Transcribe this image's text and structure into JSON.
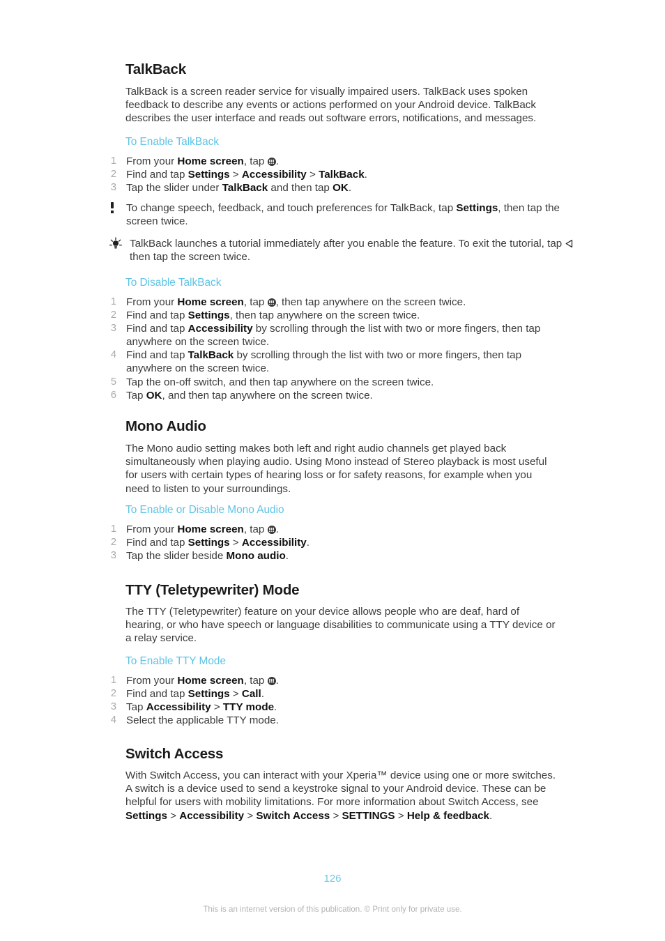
{
  "page": {
    "number": "126",
    "footer_note": "This is an internet version of this publication. © Print only for private use.",
    "accent_color": "#5cc3e5",
    "page_number_color": "#6fc9e8",
    "body_text_color": "#3b3b3b",
    "step_number_color": "#a7a9ac"
  },
  "sections": [
    {
      "id": "talkback",
      "title": "TalkBack",
      "intro": "TalkBack is a screen reader service for visually impaired users. TalkBack uses spoken feedback to describe any events or actions performed on your Android device. TalkBack describes the user interface and reads out software errors, notifications, and messages.",
      "subsections": [
        {
          "id": "to-enable-talkback",
          "heading": "To Enable TalkBack",
          "steps": [
            {
              "num": "1",
              "parts": [
                {
                  "t": "From your ",
                  "b": false
                },
                {
                  "t": "Home screen",
                  "b": true
                },
                {
                  "t": ", tap ",
                  "b": false
                },
                {
                  "icon": "app-drawer-icon"
                },
                {
                  "t": ".",
                  "b": false
                }
              ]
            },
            {
              "num": "2",
              "parts": [
                {
                  "t": "Find and tap ",
                  "b": false
                },
                {
                  "t": "Settings",
                  "b": true
                },
                {
                  "t": " > ",
                  "b": false
                },
                {
                  "t": "Accessibility",
                  "b": true
                },
                {
                  "t": " > ",
                  "b": false
                },
                {
                  "t": "TalkBack",
                  "b": true
                },
                {
                  "t": ".",
                  "b": false
                }
              ]
            },
            {
              "num": "3",
              "parts": [
                {
                  "t": "Tap the slider under ",
                  "b": false
                },
                {
                  "t": "TalkBack",
                  "b": true
                },
                {
                  "t": " and then tap ",
                  "b": false
                },
                {
                  "t": "OK",
                  "b": true
                },
                {
                  "t": ".",
                  "b": false
                }
              ]
            }
          ]
        }
      ],
      "callouts": [
        {
          "id": "talkback-note",
          "icon": "exclamation-icon",
          "parts": [
            {
              "t": "To change speech, feedback, and touch preferences for TalkBack, tap ",
              "b": false
            },
            {
              "t": "Settings",
              "b": true
            },
            {
              "t": ", then tap the screen twice.",
              "b": false
            }
          ]
        },
        {
          "id": "talkback-tip",
          "icon": "lightbulb-icon",
          "parts": [
            {
              "t": "TalkBack launches a tutorial immediately after you enable the feature. To exit the tutorial, tap ",
              "b": false
            },
            {
              "icon": "back-arrow-icon"
            },
            {
              "t": " then tap the screen twice.",
              "b": false
            }
          ]
        }
      ],
      "subsections2": [
        {
          "id": "to-disable-talkback",
          "heading": "To Disable TalkBack",
          "steps": [
            {
              "num": "1",
              "parts": [
                {
                  "t": "From your ",
                  "b": false
                },
                {
                  "t": "Home screen",
                  "b": true
                },
                {
                  "t": ", tap ",
                  "b": false
                },
                {
                  "icon": "app-drawer-icon"
                },
                {
                  "t": ", then tap anywhere on the screen twice.",
                  "b": false
                }
              ]
            },
            {
              "num": "2",
              "parts": [
                {
                  "t": "Find and tap ",
                  "b": false
                },
                {
                  "t": "Settings",
                  "b": true
                },
                {
                  "t": ", then tap anywhere on the screen twice.",
                  "b": false
                }
              ]
            },
            {
              "num": "3",
              "parts": [
                {
                  "t": "Find and tap ",
                  "b": false
                },
                {
                  "t": "Accessibility",
                  "b": true
                },
                {
                  "t": " by scrolling through the list with two or more fingers, then tap anywhere on the screen twice.",
                  "b": false
                }
              ]
            },
            {
              "num": "4",
              "parts": [
                {
                  "t": "Find and tap ",
                  "b": false
                },
                {
                  "t": "TalkBack",
                  "b": true
                },
                {
                  "t": " by scrolling through the list with two or more fingers, then tap anywhere on the screen twice.",
                  "b": false
                }
              ]
            },
            {
              "num": "5",
              "parts": [
                {
                  "t": "Tap the on-off switch, and then tap anywhere on the screen twice.",
                  "b": false
                }
              ]
            },
            {
              "num": "6",
              "parts": [
                {
                  "t": "Tap ",
                  "b": false
                },
                {
                  "t": "OK",
                  "b": true
                },
                {
                  "t": ", and then tap anywhere on the screen twice.",
                  "b": false
                }
              ]
            }
          ]
        }
      ]
    },
    {
      "id": "mono-audio",
      "title": "Mono Audio",
      "intro": "The Mono audio setting makes both left and right audio channels get played back simultaneously when playing audio. Using Mono instead of Stereo playback is most useful for users with certain types of hearing loss or for safety reasons, for example when you need to listen to your surroundings.",
      "subsections": [
        {
          "id": "to-enable-or-disable-mono-audio",
          "heading": "To Enable or Disable Mono Audio",
          "steps": [
            {
              "num": "1",
              "parts": [
                {
                  "t": "From your ",
                  "b": false
                },
                {
                  "t": "Home screen",
                  "b": true
                },
                {
                  "t": ", tap ",
                  "b": false
                },
                {
                  "icon": "app-drawer-icon"
                },
                {
                  "t": ".",
                  "b": false
                }
              ]
            },
            {
              "num": "2",
              "parts": [
                {
                  "t": "Find and tap ",
                  "b": false
                },
                {
                  "t": "Settings",
                  "b": true
                },
                {
                  "t": " > ",
                  "b": false
                },
                {
                  "t": "Accessibility",
                  "b": true
                },
                {
                  "t": ".",
                  "b": false
                }
              ]
            },
            {
              "num": "3",
              "parts": [
                {
                  "t": "Tap the slider beside ",
                  "b": false
                },
                {
                  "t": "Mono audio",
                  "b": true
                },
                {
                  "t": ".",
                  "b": false
                }
              ]
            }
          ]
        }
      ]
    },
    {
      "id": "tty-mode",
      "title": "TTY (Teletypewriter) Mode",
      "intro": "The TTY (Teletypewriter) feature on your device allows people who are deaf, hard of hearing, or who have speech or language disabilities to communicate using a TTY device or a relay service.",
      "subsections": [
        {
          "id": "to-enable-tty-mode",
          "heading": "To Enable TTY Mode",
          "steps": [
            {
              "num": "1",
              "parts": [
                {
                  "t": "From your ",
                  "b": false
                },
                {
                  "t": "Home screen",
                  "b": true
                },
                {
                  "t": ", tap ",
                  "b": false
                },
                {
                  "icon": "app-drawer-icon"
                },
                {
                  "t": ".",
                  "b": false
                }
              ]
            },
            {
              "num": "2",
              "parts": [
                {
                  "t": "Find and tap ",
                  "b": false
                },
                {
                  "t": "Settings",
                  "b": true
                },
                {
                  "t": " > ",
                  "b": false
                },
                {
                  "t": "Call",
                  "b": true
                },
                {
                  "t": ".",
                  "b": false
                }
              ]
            },
            {
              "num": "3",
              "parts": [
                {
                  "t": "Tap ",
                  "b": false
                },
                {
                  "t": "Accessibility",
                  "b": true
                },
                {
                  "t": " > ",
                  "b": false
                },
                {
                  "t": "TTY mode",
                  "b": true
                },
                {
                  "t": ".",
                  "b": false
                }
              ]
            },
            {
              "num": "4",
              "parts": [
                {
                  "t": "Select the applicable TTY mode.",
                  "b": false
                }
              ]
            }
          ]
        }
      ]
    },
    {
      "id": "switch-access",
      "title": "Switch Access",
      "intro_parts": [
        {
          "t": "With Switch Access, you can interact with your Xperia™ device using one or more switches. A switch is a device used to send a keystroke signal to your Android device. These can be helpful for users with mobility limitations. For more information about Switch Access, see ",
          "b": false
        },
        {
          "t": "Settings",
          "b": true
        },
        {
          "t": " > ",
          "b": false
        },
        {
          "t": "Accessibility",
          "b": true
        },
        {
          "t": " > ",
          "b": false
        },
        {
          "t": "Switch Access",
          "b": true
        },
        {
          "t": " > ",
          "b": false
        },
        {
          "t": "SETTINGS",
          "b": true
        },
        {
          "t": " > ",
          "b": false
        },
        {
          "t": "Help & feedback",
          "b": true
        },
        {
          "t": ".",
          "b": false
        }
      ]
    }
  ]
}
